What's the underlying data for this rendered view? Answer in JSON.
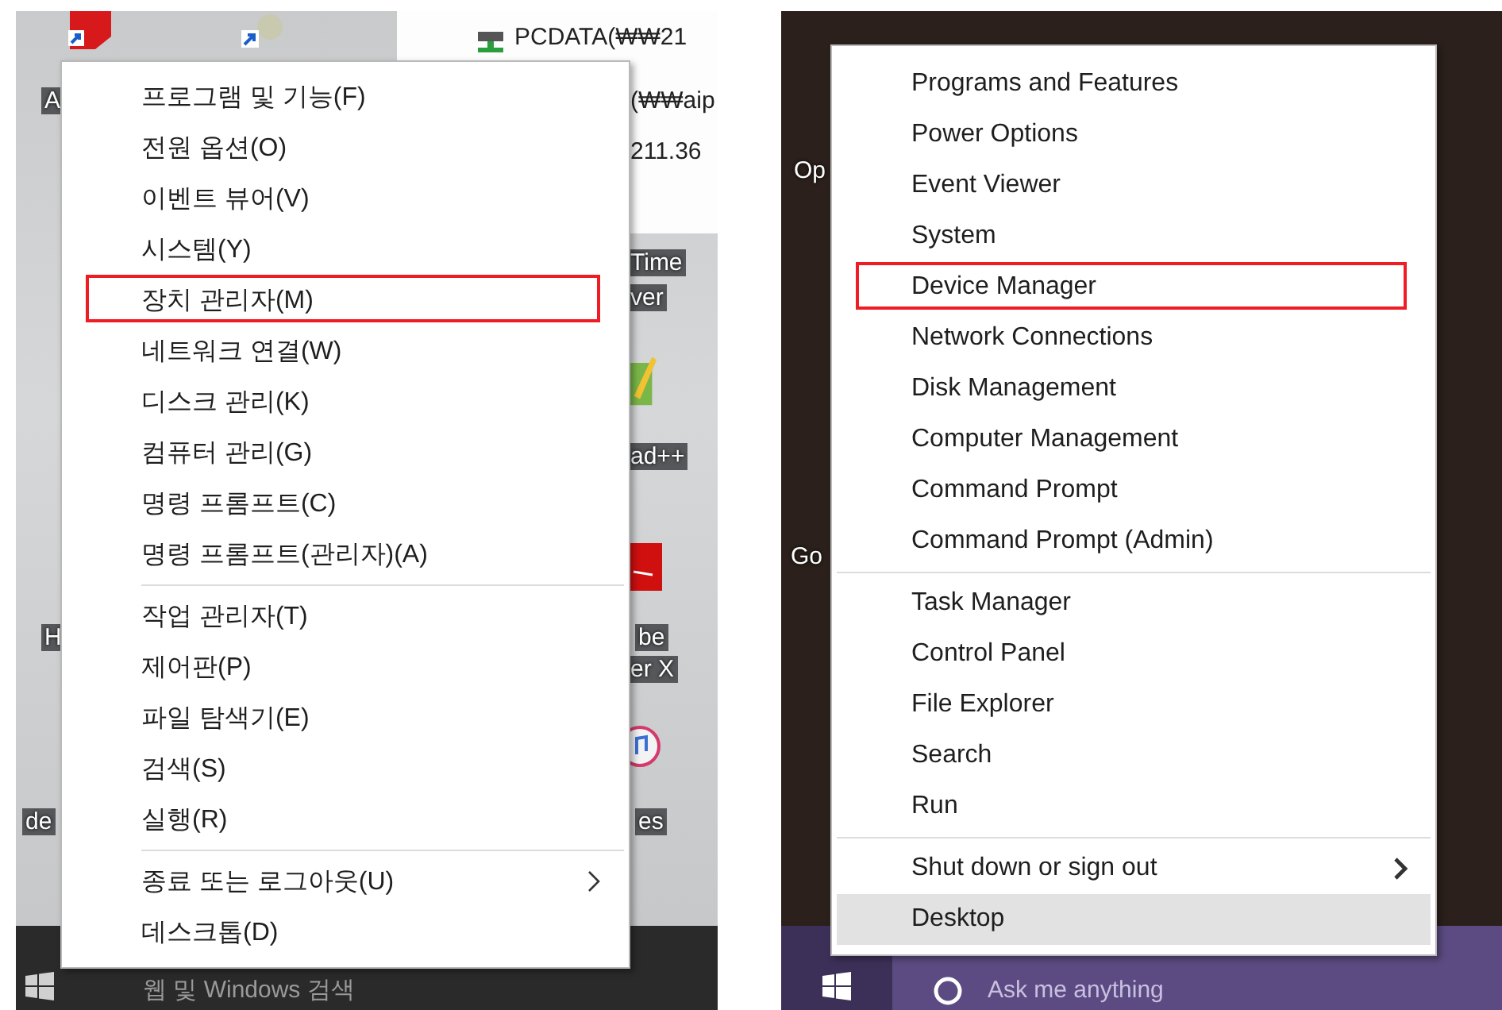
{
  "panels": [
    {
      "desktop": {
        "labels": [
          "PCDATA(₩₩21",
          "A",
          "(₩₩aip",
          "211.36",
          "Time",
          "ver",
          "ad++",
          "H",
          "be",
          "er X",
          "de",
          "es"
        ]
      },
      "menu": {
        "groups": [
          [
            {
              "label": "프로그램 및 기능(F)",
              "annotated": false,
              "hovered": false,
              "submenu": false
            },
            {
              "label": "전원 옵션(O)",
              "annotated": false,
              "hovered": false,
              "submenu": false
            },
            {
              "label": "이벤트 뷰어(V)",
              "annotated": false,
              "hovered": false,
              "submenu": false
            },
            {
              "label": "시스템(Y)",
              "annotated": false,
              "hovered": false,
              "submenu": false
            },
            {
              "label": "장치 관리자(M)",
              "annotated": true,
              "hovered": false,
              "submenu": false
            },
            {
              "label": "네트워크 연결(W)",
              "annotated": false,
              "hovered": false,
              "submenu": false
            },
            {
              "label": "디스크 관리(K)",
              "annotated": false,
              "hovered": false,
              "submenu": false
            },
            {
              "label": "컴퓨터 관리(G)",
              "annotated": false,
              "hovered": false,
              "submenu": false
            },
            {
              "label": "명령 프롬프트(C)",
              "annotated": false,
              "hovered": false,
              "submenu": false
            },
            {
              "label": "명령 프롬프트(관리자)(A)",
              "annotated": false,
              "hovered": false,
              "submenu": false
            }
          ],
          [
            {
              "label": "작업 관리자(T)",
              "annotated": false,
              "hovered": false,
              "submenu": false
            },
            {
              "label": "제어판(P)",
              "annotated": false,
              "hovered": false,
              "submenu": false
            },
            {
              "label": "파일 탐색기(E)",
              "annotated": false,
              "hovered": false,
              "submenu": false
            },
            {
              "label": "검색(S)",
              "annotated": false,
              "hovered": false,
              "submenu": false
            },
            {
              "label": "실행(R)",
              "annotated": false,
              "hovered": false,
              "submenu": false
            }
          ],
          [
            {
              "label": "종료 또는 로그아웃(U)",
              "annotated": false,
              "hovered": false,
              "submenu": true
            },
            {
              "label": "데스크톱(D)",
              "annotated": false,
              "hovered": false,
              "submenu": false
            }
          ]
        ]
      },
      "taskbar": {
        "search_placeholder": "웹 및 Windows 검색"
      }
    },
    {
      "desktop": {
        "labels": [
          "Op",
          "Go"
        ]
      },
      "menu": {
        "groups": [
          [
            {
              "label": "Programs and Features",
              "annotated": false,
              "hovered": false,
              "submenu": false
            },
            {
              "label": "Power Options",
              "annotated": false,
              "hovered": false,
              "submenu": false
            },
            {
              "label": "Event Viewer",
              "annotated": false,
              "hovered": false,
              "submenu": false
            },
            {
              "label": "System",
              "annotated": false,
              "hovered": false,
              "submenu": false
            },
            {
              "label": "Device Manager",
              "annotated": true,
              "hovered": false,
              "submenu": false
            },
            {
              "label": "Network Connections",
              "annotated": false,
              "hovered": false,
              "submenu": false
            },
            {
              "label": "Disk Management",
              "annotated": false,
              "hovered": false,
              "submenu": false
            },
            {
              "label": "Computer Management",
              "annotated": false,
              "hovered": false,
              "submenu": false
            },
            {
              "label": "Command Prompt",
              "annotated": false,
              "hovered": false,
              "submenu": false
            },
            {
              "label": "Command Prompt (Admin)",
              "annotated": false,
              "hovered": false,
              "submenu": false
            }
          ],
          [
            {
              "label": "Task Manager",
              "annotated": false,
              "hovered": false,
              "submenu": false
            },
            {
              "label": "Control Panel",
              "annotated": false,
              "hovered": false,
              "submenu": false
            },
            {
              "label": "File Explorer",
              "annotated": false,
              "hovered": false,
              "submenu": false
            },
            {
              "label": "Search",
              "annotated": false,
              "hovered": false,
              "submenu": false
            },
            {
              "label": "Run",
              "annotated": false,
              "hovered": false,
              "submenu": false
            }
          ],
          [
            {
              "label": "Shut down or sign out",
              "annotated": false,
              "hovered": false,
              "submenu": true
            },
            {
              "label": "Desktop",
              "annotated": false,
              "hovered": true,
              "submenu": false
            }
          ]
        ]
      },
      "taskbar": {
        "search_placeholder": "Ask me anything"
      }
    }
  ]
}
